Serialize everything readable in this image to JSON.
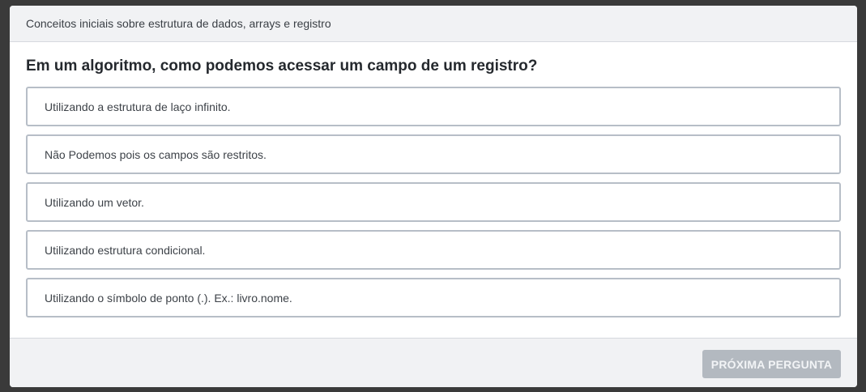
{
  "header": {
    "title": "Conceitos iniciais sobre estrutura de dados, arrays e registro"
  },
  "question": {
    "text": "Em um algoritmo, como podemos acessar um campo de um registro?"
  },
  "options": [
    {
      "label": "Utilizando a estrutura de laço infinito."
    },
    {
      "label": "Não Podemos pois os campos são restritos."
    },
    {
      "label": "Utilizando um vetor."
    },
    {
      "label": "Utilizando estrutura condicional."
    },
    {
      "label": "Utilizando o símbolo de ponto (.). Ex.: livro.nome."
    }
  ],
  "footer": {
    "next_label": "PRÓXIMA PERGUNTA"
  }
}
